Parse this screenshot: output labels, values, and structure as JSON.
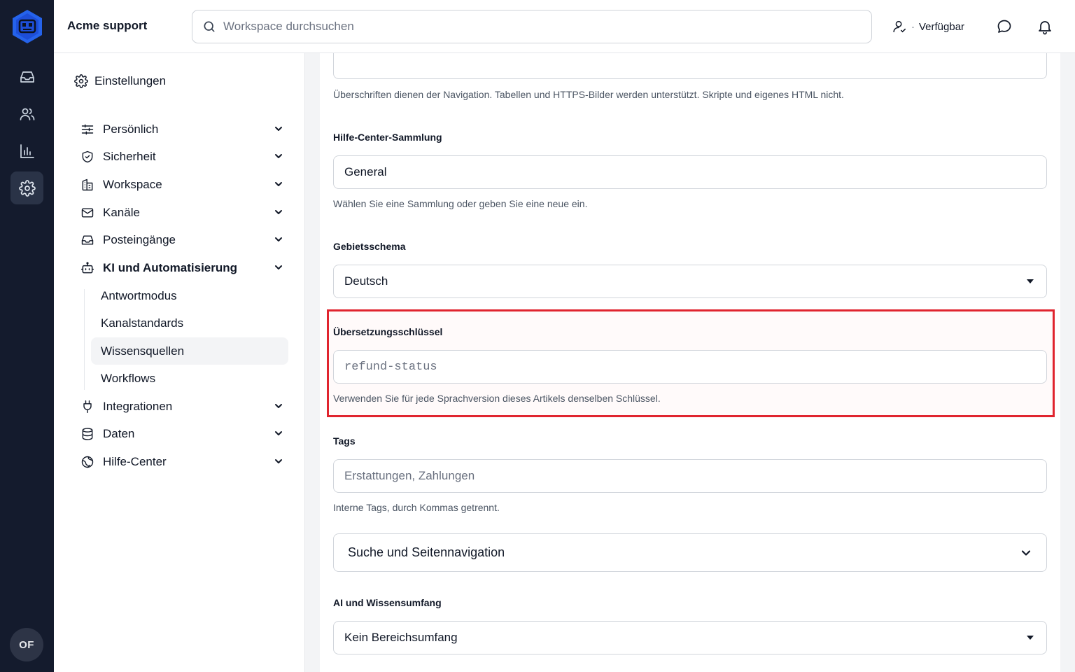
{
  "app": {
    "workspace_name": "Acme support",
    "user_initials": "OF"
  },
  "rail": {
    "items": [
      {
        "icon": "inbox-icon"
      },
      {
        "icon": "users-icon"
      },
      {
        "icon": "bar-chart-icon"
      },
      {
        "icon": "gear-icon",
        "active": true
      }
    ]
  },
  "topbar": {
    "search_placeholder": "Workspace durchsuchen",
    "status_label": "Verfügbar",
    "status_separator": "·"
  },
  "settings_nav": {
    "header": "Einstellungen",
    "items": [
      {
        "label": "Persönlich",
        "icon": "sliders-icon"
      },
      {
        "label": "Sicherheit",
        "icon": "shield-icon"
      },
      {
        "label": "Workspace",
        "icon": "building-icon"
      },
      {
        "label": "Kanäle",
        "icon": "mail-icon"
      },
      {
        "label": "Posteingänge",
        "icon": "inbox-icon"
      },
      {
        "label": "KI und Automatisierung",
        "icon": "bot-icon",
        "expanded": true
      },
      {
        "label": "Integrationen",
        "icon": "plug-icon"
      },
      {
        "label": "Daten",
        "icon": "database-icon"
      },
      {
        "label": "Hilfe-Center",
        "icon": "globe-icon"
      }
    ],
    "sub_items": [
      {
        "label": "Antwortmodus"
      },
      {
        "label": "Kanalstandards"
      },
      {
        "label": "Wissensquellen",
        "active": true
      },
      {
        "label": "Workflows"
      }
    ]
  },
  "form": {
    "body_help": "Überschriften dienen der Navigation. Tabellen und HTTPS-Bilder werden unterstützt. Skripte und eigenes HTML nicht.",
    "collection": {
      "label": "Hilfe-Center-Sammlung",
      "value": "General",
      "help": "Wählen Sie eine Sammlung oder geben Sie eine neue ein."
    },
    "locale": {
      "label": "Gebietsschema",
      "value": "Deutsch"
    },
    "translation_key": {
      "label": "Übersetzungsschlüssel",
      "placeholder": "refund-status",
      "help": "Verwenden Sie für jede Sprachversion dieses Artikels denselben Schlüssel."
    },
    "tags": {
      "label": "Tags",
      "placeholder": "Erstattungen, Zahlungen",
      "help": "Interne Tags, durch Kommas getrennt."
    },
    "search_nav_section": "Suche und Seitennavigation",
    "ai_scope": {
      "label": "AI und Wissensumfang",
      "value": "Kein Bereichsumfang"
    }
  },
  "colors": {
    "rail_bg": "#141b2d",
    "logo_blue": "#2563eb",
    "highlight_red": "#e0242e"
  }
}
